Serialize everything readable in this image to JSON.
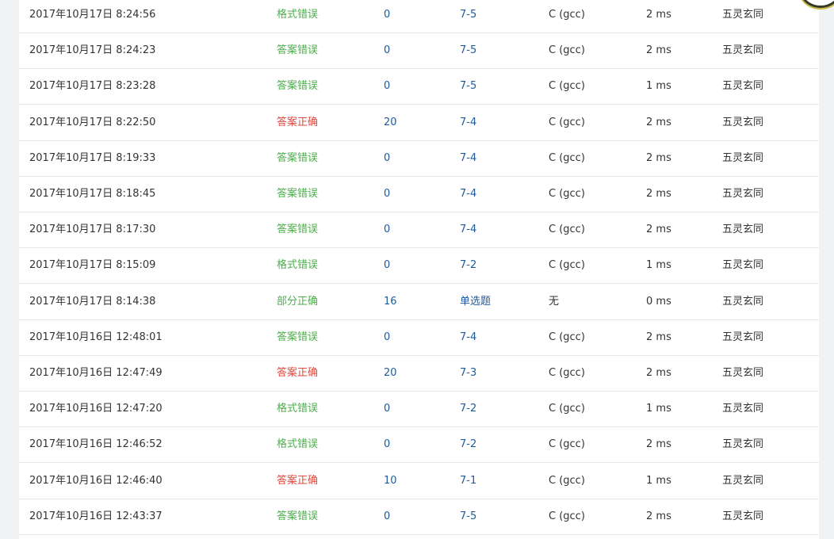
{
  "colors": {
    "status_wrong": "#4cae4c",
    "status_correct": "#e0483e",
    "link": "#1e5a9c",
    "text": "#333333",
    "row_border": "#e8e8e8",
    "page_bg": "#f1f2f4"
  },
  "rows": [
    {
      "time": "2017年10月17日 8:24:56",
      "status": "格式错误",
      "status_color": "green",
      "score": "0",
      "problem": "7-5",
      "language": "C (gcc)",
      "time_used": "2 ms",
      "user": "五灵玄同"
    },
    {
      "time": "2017年10月17日 8:24:23",
      "status": "答案错误",
      "status_color": "green",
      "score": "0",
      "problem": "7-5",
      "language": "C (gcc)",
      "time_used": "2 ms",
      "user": "五灵玄同"
    },
    {
      "time": "2017年10月17日 8:23:28",
      "status": "答案错误",
      "status_color": "green",
      "score": "0",
      "problem": "7-5",
      "language": "C (gcc)",
      "time_used": "1 ms",
      "user": "五灵玄同"
    },
    {
      "time": "2017年10月17日 8:22:50",
      "status": "答案正确",
      "status_color": "red",
      "score": "20",
      "problem": "7-4",
      "language": "C (gcc)",
      "time_used": "2 ms",
      "user": "五灵玄同"
    },
    {
      "time": "2017年10月17日 8:19:33",
      "status": "答案错误",
      "status_color": "green",
      "score": "0",
      "problem": "7-4",
      "language": "C (gcc)",
      "time_used": "2 ms",
      "user": "五灵玄同"
    },
    {
      "time": "2017年10月17日 8:18:45",
      "status": "答案错误",
      "status_color": "green",
      "score": "0",
      "problem": "7-4",
      "language": "C (gcc)",
      "time_used": "2 ms",
      "user": "五灵玄同"
    },
    {
      "time": "2017年10月17日 8:17:30",
      "status": "答案错误",
      "status_color": "green",
      "score": "0",
      "problem": "7-4",
      "language": "C (gcc)",
      "time_used": "2 ms",
      "user": "五灵玄同"
    },
    {
      "time": "2017年10月17日 8:15:09",
      "status": "格式错误",
      "status_color": "green",
      "score": "0",
      "problem": "7-2",
      "language": "C (gcc)",
      "time_used": "1 ms",
      "user": "五灵玄同"
    },
    {
      "time": "2017年10月17日 8:14:38",
      "status": "部分正确",
      "status_color": "green",
      "score": "16",
      "problem": "单选题",
      "language": "无",
      "time_used": "0 ms",
      "user": "五灵玄同"
    },
    {
      "time": "2017年10月16日 12:48:01",
      "status": "答案错误",
      "status_color": "green",
      "score": "0",
      "problem": "7-4",
      "language": "C (gcc)",
      "time_used": "2 ms",
      "user": "五灵玄同"
    },
    {
      "time": "2017年10月16日 12:47:49",
      "status": "答案正确",
      "status_color": "red",
      "score": "20",
      "problem": "7-3",
      "language": "C (gcc)",
      "time_used": "2 ms",
      "user": "五灵玄同"
    },
    {
      "time": "2017年10月16日 12:47:20",
      "status": "格式错误",
      "status_color": "green",
      "score": "0",
      "problem": "7-2",
      "language": "C (gcc)",
      "time_used": "1 ms",
      "user": "五灵玄同"
    },
    {
      "time": "2017年10月16日 12:46:52",
      "status": "格式错误",
      "status_color": "green",
      "score": "0",
      "problem": "7-2",
      "language": "C (gcc)",
      "time_used": "2 ms",
      "user": "五灵玄同"
    },
    {
      "time": "2017年10月16日 12:46:40",
      "status": "答案正确",
      "status_color": "red",
      "score": "10",
      "problem": "7-1",
      "language": "C (gcc)",
      "time_used": "1 ms",
      "user": "五灵玄同"
    },
    {
      "time": "2017年10月16日 12:43:37",
      "status": "答案错误",
      "status_color": "green",
      "score": "0",
      "problem": "7-5",
      "language": "C (gcc)",
      "time_used": "2 ms",
      "user": "五灵玄同"
    }
  ]
}
